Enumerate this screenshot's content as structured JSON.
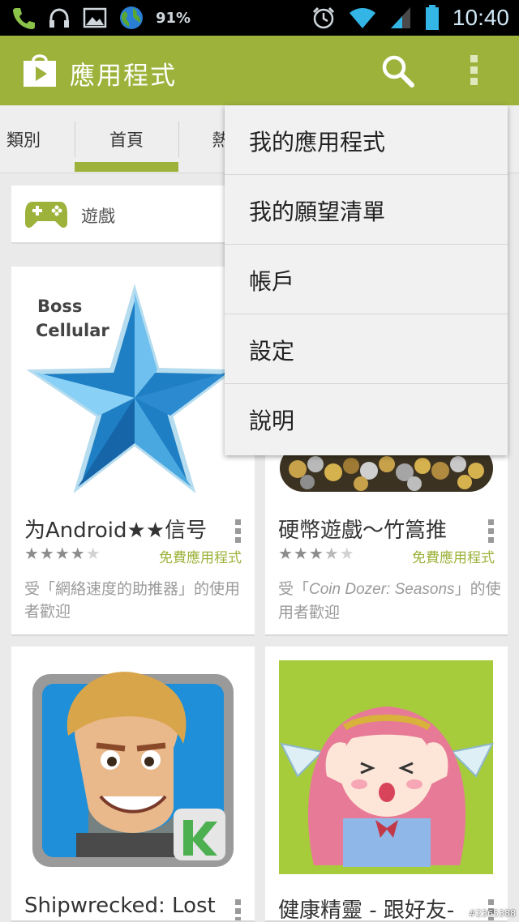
{
  "status_bar": {
    "battery_percent_text": "91%",
    "time": "10:40",
    "icons": [
      "phone-icon",
      "headset-icon",
      "picture-icon",
      "globe-icon",
      "alarm-icon",
      "wifi-icon",
      "signal-icon",
      "battery-icon"
    ]
  },
  "action_bar": {
    "title": "應用程式",
    "icons": [
      "play-store-bag-icon",
      "search-icon",
      "overflow-menu-icon"
    ]
  },
  "tabs": [
    {
      "label": "類別",
      "selected": false
    },
    {
      "label": "首頁",
      "selected": true
    },
    {
      "label": "熱",
      "selected": false
    }
  ],
  "category_card": {
    "label": "遊戲",
    "icon": "gamepad-icon"
  },
  "cards": [
    {
      "title": "为Android★★信号",
      "rating": 4,
      "price": "免費應用程式",
      "reason": "受「網絡速度的助推器」的使用者歡迎",
      "art_label_1": "Boss",
      "art_label_2": "Cellular"
    },
    {
      "title": "硬幣遊戲〜竹篙推",
      "rating": 3.5,
      "price": "免費應用程式",
      "reason_prefix": "受「",
      "reason_italic": "Coin Dozer: Seasons",
      "reason_suffix": "」的使用者歡迎"
    },
    {
      "title": "Shipwrecked: Lost I"
    },
    {
      "title": "健康精靈 - 跟好友-"
    }
  ],
  "overflow_menu": [
    {
      "label": "我的應用程式"
    },
    {
      "label": "我的願望清單"
    },
    {
      "label": "帳戶"
    },
    {
      "label": "設定"
    },
    {
      "label": "說明"
    }
  ],
  "watermark": "#2365388",
  "colors": {
    "accent": "#9cb23b",
    "status_bar": "#000000",
    "menu_bg": "#f1f1f1"
  }
}
